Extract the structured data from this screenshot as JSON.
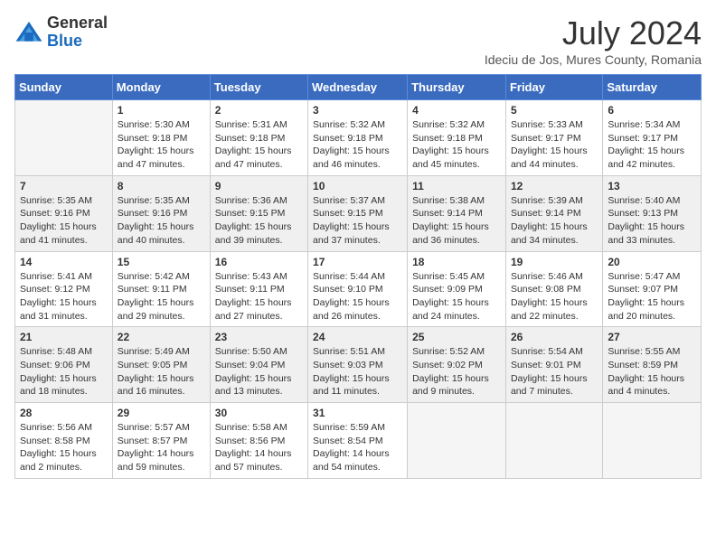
{
  "logo": {
    "general": "General",
    "blue": "Blue"
  },
  "title": "July 2024",
  "location": "Ideciu de Jos, Mures County, Romania",
  "days": [
    "Sunday",
    "Monday",
    "Tuesday",
    "Wednesday",
    "Thursday",
    "Friday",
    "Saturday"
  ],
  "weeks": [
    [
      {
        "day": "",
        "info": ""
      },
      {
        "day": "1",
        "info": "Sunrise: 5:30 AM\nSunset: 9:18 PM\nDaylight: 15 hours\nand 47 minutes."
      },
      {
        "day": "2",
        "info": "Sunrise: 5:31 AM\nSunset: 9:18 PM\nDaylight: 15 hours\nand 47 minutes."
      },
      {
        "day": "3",
        "info": "Sunrise: 5:32 AM\nSunset: 9:18 PM\nDaylight: 15 hours\nand 46 minutes."
      },
      {
        "day": "4",
        "info": "Sunrise: 5:32 AM\nSunset: 9:18 PM\nDaylight: 15 hours\nand 45 minutes."
      },
      {
        "day": "5",
        "info": "Sunrise: 5:33 AM\nSunset: 9:17 PM\nDaylight: 15 hours\nand 44 minutes."
      },
      {
        "day": "6",
        "info": "Sunrise: 5:34 AM\nSunset: 9:17 PM\nDaylight: 15 hours\nand 42 minutes."
      }
    ],
    [
      {
        "day": "7",
        "info": "Sunrise: 5:35 AM\nSunset: 9:16 PM\nDaylight: 15 hours\nand 41 minutes."
      },
      {
        "day": "8",
        "info": "Sunrise: 5:35 AM\nSunset: 9:16 PM\nDaylight: 15 hours\nand 40 minutes."
      },
      {
        "day": "9",
        "info": "Sunrise: 5:36 AM\nSunset: 9:15 PM\nDaylight: 15 hours\nand 39 minutes."
      },
      {
        "day": "10",
        "info": "Sunrise: 5:37 AM\nSunset: 9:15 PM\nDaylight: 15 hours\nand 37 minutes."
      },
      {
        "day": "11",
        "info": "Sunrise: 5:38 AM\nSunset: 9:14 PM\nDaylight: 15 hours\nand 36 minutes."
      },
      {
        "day": "12",
        "info": "Sunrise: 5:39 AM\nSunset: 9:14 PM\nDaylight: 15 hours\nand 34 minutes."
      },
      {
        "day": "13",
        "info": "Sunrise: 5:40 AM\nSunset: 9:13 PM\nDaylight: 15 hours\nand 33 minutes."
      }
    ],
    [
      {
        "day": "14",
        "info": "Sunrise: 5:41 AM\nSunset: 9:12 PM\nDaylight: 15 hours\nand 31 minutes."
      },
      {
        "day": "15",
        "info": "Sunrise: 5:42 AM\nSunset: 9:11 PM\nDaylight: 15 hours\nand 29 minutes."
      },
      {
        "day": "16",
        "info": "Sunrise: 5:43 AM\nSunset: 9:11 PM\nDaylight: 15 hours\nand 27 minutes."
      },
      {
        "day": "17",
        "info": "Sunrise: 5:44 AM\nSunset: 9:10 PM\nDaylight: 15 hours\nand 26 minutes."
      },
      {
        "day": "18",
        "info": "Sunrise: 5:45 AM\nSunset: 9:09 PM\nDaylight: 15 hours\nand 24 minutes."
      },
      {
        "day": "19",
        "info": "Sunrise: 5:46 AM\nSunset: 9:08 PM\nDaylight: 15 hours\nand 22 minutes."
      },
      {
        "day": "20",
        "info": "Sunrise: 5:47 AM\nSunset: 9:07 PM\nDaylight: 15 hours\nand 20 minutes."
      }
    ],
    [
      {
        "day": "21",
        "info": "Sunrise: 5:48 AM\nSunset: 9:06 PM\nDaylight: 15 hours\nand 18 minutes."
      },
      {
        "day": "22",
        "info": "Sunrise: 5:49 AM\nSunset: 9:05 PM\nDaylight: 15 hours\nand 16 minutes."
      },
      {
        "day": "23",
        "info": "Sunrise: 5:50 AM\nSunset: 9:04 PM\nDaylight: 15 hours\nand 13 minutes."
      },
      {
        "day": "24",
        "info": "Sunrise: 5:51 AM\nSunset: 9:03 PM\nDaylight: 15 hours\nand 11 minutes."
      },
      {
        "day": "25",
        "info": "Sunrise: 5:52 AM\nSunset: 9:02 PM\nDaylight: 15 hours\nand 9 minutes."
      },
      {
        "day": "26",
        "info": "Sunrise: 5:54 AM\nSunset: 9:01 PM\nDaylight: 15 hours\nand 7 minutes."
      },
      {
        "day": "27",
        "info": "Sunrise: 5:55 AM\nSunset: 8:59 PM\nDaylight: 15 hours\nand 4 minutes."
      }
    ],
    [
      {
        "day": "28",
        "info": "Sunrise: 5:56 AM\nSunset: 8:58 PM\nDaylight: 15 hours\nand 2 minutes."
      },
      {
        "day": "29",
        "info": "Sunrise: 5:57 AM\nSunset: 8:57 PM\nDaylight: 14 hours\nand 59 minutes."
      },
      {
        "day": "30",
        "info": "Sunrise: 5:58 AM\nSunset: 8:56 PM\nDaylight: 14 hours\nand 57 minutes."
      },
      {
        "day": "31",
        "info": "Sunrise: 5:59 AM\nSunset: 8:54 PM\nDaylight: 14 hours\nand 54 minutes."
      },
      {
        "day": "",
        "info": ""
      },
      {
        "day": "",
        "info": ""
      },
      {
        "day": "",
        "info": ""
      }
    ]
  ]
}
